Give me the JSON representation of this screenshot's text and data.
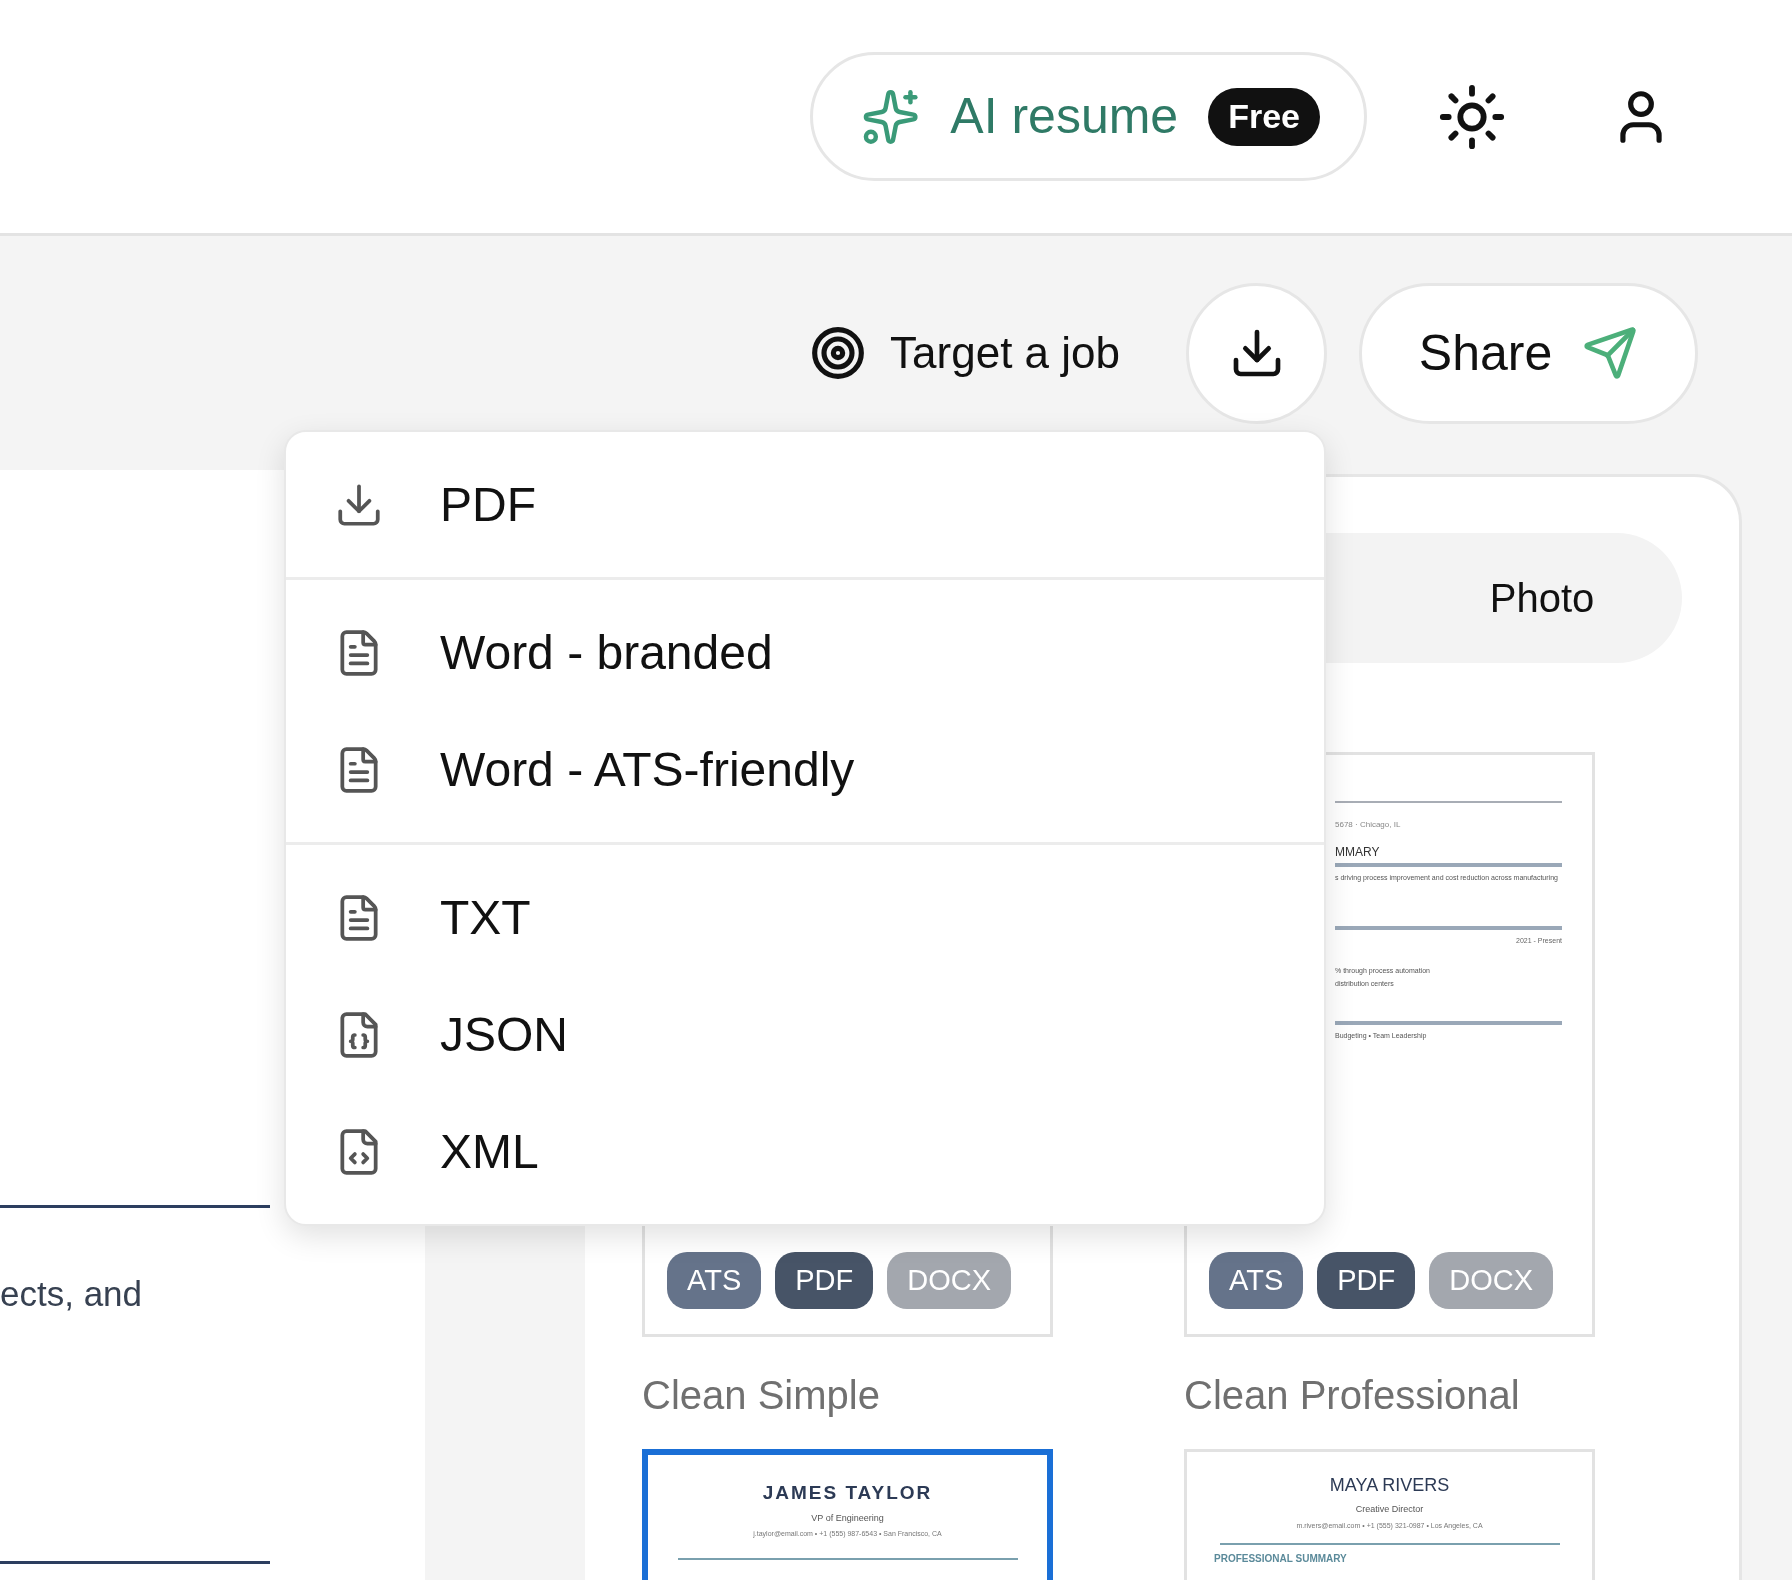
{
  "header": {
    "ai_button": {
      "label": "AI resume",
      "badge": "Free"
    }
  },
  "toolbar": {
    "target_job": "Target a job",
    "share": "Share"
  },
  "export_menu": {
    "groups": [
      [
        {
          "label": "PDF",
          "kind": "download"
        }
      ],
      [
        {
          "label": "Word - branded",
          "kind": "document"
        },
        {
          "label": "Word - ATS-friendly",
          "kind": "document"
        }
      ],
      [
        {
          "label": "TXT",
          "kind": "document"
        },
        {
          "label": "JSON",
          "kind": "braces"
        },
        {
          "label": "XML",
          "kind": "code"
        }
      ]
    ]
  },
  "editor": {
    "text": "ects, and"
  },
  "templates": {
    "tabs": [
      {
        "label": "Photo",
        "selected": false
      }
    ],
    "cards": [
      {
        "name": "Clean Simple",
        "selected": false,
        "badges": [
          {
            "label": "ATS",
            "color": "#65738a"
          },
          {
            "label": "PDF",
            "color": "#475467"
          },
          {
            "label": "DOCX",
            "color": "#a3a7ae"
          }
        ]
      },
      {
        "name": "Clean Professional",
        "selected": false,
        "badges": [
          {
            "label": "ATS",
            "color": "#65738a"
          },
          {
            "label": "PDF",
            "color": "#475467"
          },
          {
            "label": "DOCX",
            "color": "#a3a7ae"
          }
        ],
        "preview": {
          "contact": "5678 · Chicago, IL",
          "heading": "MMARY",
          "summary": "s driving process improvement and cost reduction across manufacturing",
          "date": "2021 - Present",
          "bullets": [
            "% through process automation",
            "distribution centers"
          ],
          "skills": "Budgeting • Team Leadership"
        }
      },
      {
        "selected": true,
        "resume": {
          "name": "JAMES TAYLOR",
          "title": "VP of Engineering",
          "contact": "j.taylor@email.com • +1 (555) 987-6543 • San Francisco, CA"
        }
      },
      {
        "selected": false,
        "resume": {
          "name": "MAYA RIVERS",
          "title": "Creative Director",
          "contact": "m.rivers@email.com • +1 (555) 321-0987 • Los Angeles, CA",
          "section": "PROFESSIONAL SUMMARY"
        }
      }
    ]
  }
}
